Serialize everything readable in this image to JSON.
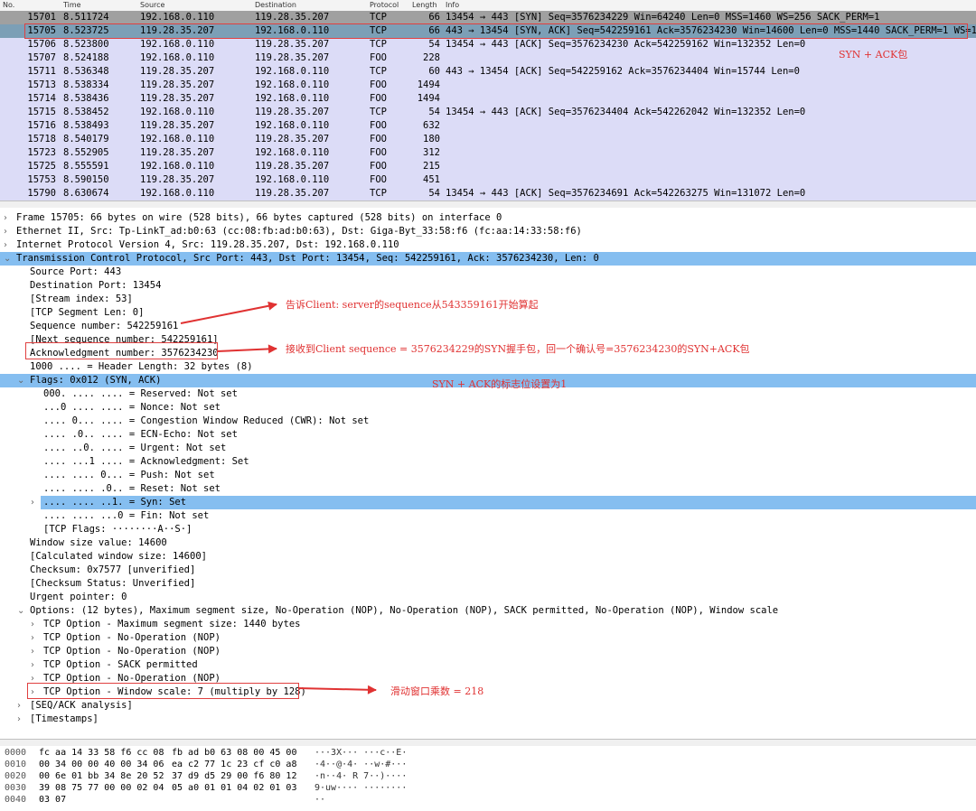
{
  "packet_list": {
    "columns": {
      "no": "No.",
      "time": "Time",
      "source": "Source",
      "destination": "Destination",
      "protocol": "Protocol",
      "length": "Length",
      "info": "Info"
    },
    "rows": [
      {
        "no": "15701",
        "time": "8.511724",
        "src": "192.168.0.110",
        "dst": "119.28.35.207",
        "proto": "TCP",
        "len": "66",
        "info": "13454 → 443 [SYN] Seq=3576234229 Win=64240 Len=0 MSS=1460 WS=256 SACK_PERM=1"
      },
      {
        "no": "15705",
        "time": "8.523725",
        "src": "119.28.35.207",
        "dst": "192.168.0.110",
        "proto": "TCP",
        "len": "66",
        "info": "443 → 13454 [SYN, ACK] Seq=542259161 Ack=3576234230 Win=14600 Len=0 MSS=1440 SACK_PERM=1 WS=128"
      },
      {
        "no": "15706",
        "time": "8.523800",
        "src": "192.168.0.110",
        "dst": "119.28.35.207",
        "proto": "TCP",
        "len": "54",
        "info": "13454 → 443 [ACK] Seq=3576234230 Ack=542259162 Win=132352 Len=0"
      },
      {
        "no": "15707",
        "time": "8.524188",
        "src": "192.168.0.110",
        "dst": "119.28.35.207",
        "proto": "FOO",
        "len": "228",
        "info": ""
      },
      {
        "no": "15711",
        "time": "8.536348",
        "src": "119.28.35.207",
        "dst": "192.168.0.110",
        "proto": "TCP",
        "len": "60",
        "info": "443 → 13454 [ACK] Seq=542259162 Ack=3576234404 Win=15744 Len=0"
      },
      {
        "no": "15713",
        "time": "8.538334",
        "src": "119.28.35.207",
        "dst": "192.168.0.110",
        "proto": "FOO",
        "len": "1494",
        "info": ""
      },
      {
        "no": "15714",
        "time": "8.538436",
        "src": "119.28.35.207",
        "dst": "192.168.0.110",
        "proto": "FOO",
        "len": "1494",
        "info": ""
      },
      {
        "no": "15715",
        "time": "8.538452",
        "src": "192.168.0.110",
        "dst": "119.28.35.207",
        "proto": "TCP",
        "len": "54",
        "info": "13454 → 443 [ACK] Seq=3576234404 Ack=542262042 Win=132352 Len=0"
      },
      {
        "no": "15716",
        "time": "8.538493",
        "src": "119.28.35.207",
        "dst": "192.168.0.110",
        "proto": "FOO",
        "len": "632",
        "info": ""
      },
      {
        "no": "15718",
        "time": "8.540179",
        "src": "192.168.0.110",
        "dst": "119.28.35.207",
        "proto": "FOO",
        "len": "180",
        "info": ""
      },
      {
        "no": "15723",
        "time": "8.552905",
        "src": "119.28.35.207",
        "dst": "192.168.0.110",
        "proto": "FOO",
        "len": "312",
        "info": ""
      },
      {
        "no": "15725",
        "time": "8.555591",
        "src": "192.168.0.110",
        "dst": "119.28.35.207",
        "proto": "FOO",
        "len": "215",
        "info": ""
      },
      {
        "no": "15753",
        "time": "8.590150",
        "src": "119.28.35.207",
        "dst": "192.168.0.110",
        "proto": "FOO",
        "len": "451",
        "info": ""
      },
      {
        "no": "15790",
        "time": "8.630674",
        "src": "192.168.0.110",
        "dst": "119.28.35.207",
        "proto": "TCP",
        "len": "54",
        "info": "13454 → 443 [ACK] Seq=3576234691 Ack=542263275 Win=131072 Len=0"
      }
    ]
  },
  "annotations": {
    "syn_ack_packet": "SYN + ACK包",
    "server_seq": "告诉Client: server的sequence从543359161开始算起",
    "ack_number": "接收到Client sequence = 3576234229的SYN握手包，回一个确认号=3576234230的SYN+ACK包",
    "flags": "SYN + ACK的标志位设置为1",
    "window_scale": "滑动窗口乘数 = 218"
  },
  "details": [
    {
      "text": "Frame 15705: 66 bytes on wire (528 bits), 66 bytes captured (528 bits) on interface 0",
      "arrow": "›"
    },
    {
      "text": "Ethernet II, Src: Tp-LinkT_ad:b0:63 (cc:08:fb:ad:b0:63), Dst: Giga-Byt_33:58:f6 (fc:aa:14:33:58:f6)",
      "arrow": "›"
    },
    {
      "text": "Internet Protocol Version 4, Src: 119.28.35.207, Dst: 192.168.0.110",
      "arrow": "›"
    },
    {
      "text": "Transmission Control Protocol, Src Port: 443, Dst Port: 13454, Seq: 542259161, Ack: 3576234230, Len: 0",
      "arrow": "⌄"
    },
    {
      "text": "Source Port: 443",
      "arrow": ""
    },
    {
      "text": "Destination Port: 13454",
      "arrow": ""
    },
    {
      "text": "[Stream index: 53]",
      "arrow": ""
    },
    {
      "text": "[TCP Segment Len: 0]",
      "arrow": ""
    },
    {
      "text": "Sequence number: 542259161",
      "arrow": ""
    },
    {
      "text": "[Next sequence number: 542259161]",
      "arrow": ""
    },
    {
      "text": "Acknowledgment number: 3576234230",
      "arrow": ""
    },
    {
      "text": "1000 .... = Header Length: 32 bytes (8)",
      "arrow": ""
    },
    {
      "text": "Flags: 0x012 (SYN, ACK)",
      "arrow": "⌄"
    },
    {
      "text": "000. .... .... = Reserved: Not set",
      "arrow": ""
    },
    {
      "text": "...0 .... .... = Nonce: Not set",
      "arrow": ""
    },
    {
      "text": ".... 0... .... = Congestion Window Reduced (CWR): Not set",
      "arrow": ""
    },
    {
      "text": ".... .0.. .... = ECN-Echo: Not set",
      "arrow": ""
    },
    {
      "text": ".... ..0. .... = Urgent: Not set",
      "arrow": ""
    },
    {
      "text": ".... ...1 .... = Acknowledgment: Set",
      "arrow": ""
    },
    {
      "text": ".... .... 0... = Push: Not set",
      "arrow": ""
    },
    {
      "text": ".... .... .0.. = Reset: Not set",
      "arrow": ""
    },
    {
      "text": ".... .... ..1. = Syn: Set",
      "arrow": "›"
    },
    {
      "text": ".... .... ...0 = Fin: Not set",
      "arrow": ""
    },
    {
      "text": "[TCP Flags: ········A··S·]",
      "arrow": ""
    },
    {
      "text": "Window size value: 14600",
      "arrow": ""
    },
    {
      "text": "[Calculated window size: 14600]",
      "arrow": ""
    },
    {
      "text": "Checksum: 0x7577 [unverified]",
      "arrow": ""
    },
    {
      "text": "[Checksum Status: Unverified]",
      "arrow": ""
    },
    {
      "text": "Urgent pointer: 0",
      "arrow": ""
    },
    {
      "text": "Options: (12 bytes), Maximum segment size, No-Operation (NOP), No-Operation (NOP), SACK permitted, No-Operation (NOP), Window scale",
      "arrow": "⌄"
    },
    {
      "text": "TCP Option - Maximum segment size: 1440 bytes",
      "arrow": "›"
    },
    {
      "text": "TCP Option - No-Operation (NOP)",
      "arrow": "›"
    },
    {
      "text": "TCP Option - No-Operation (NOP)",
      "arrow": "›"
    },
    {
      "text": "TCP Option - SACK permitted",
      "arrow": "›"
    },
    {
      "text": "TCP Option - No-Operation (NOP)",
      "arrow": "›"
    },
    {
      "text": "TCP Option - Window scale: 7 (multiply by 128)",
      "arrow": "›"
    },
    {
      "text": "[SEQ/ACK analysis]",
      "arrow": "›"
    },
    {
      "text": "[Timestamps]",
      "arrow": "›"
    }
  ],
  "hex": [
    {
      "offset": "0000",
      "a": "fc aa 14 33 58 f6 cc 08",
      "b": "fb ad b0 63 08 00 45 00",
      "ascii": "···3X··· ···c··E·"
    },
    {
      "offset": "0010",
      "a": "00 34 00 00 40 00 34 06",
      "b": "ea c2 77 1c 23 cf c0 a8",
      "ascii": "·4··@·4· ··w·#···"
    },
    {
      "offset": "0020",
      "a": "00 6e 01 bb 34 8e 20 52",
      "b": "37 d9 d5 29 00 f6 80 12",
      "ascii": "·n··4· R 7··)····"
    },
    {
      "offset": "0030",
      "a": "39 08 75 77 00 00 02 04",
      "b": "05 a0 01 01 04 02 01 03",
      "ascii": "9·uw···· ········"
    },
    {
      "offset": "0040",
      "a": "03 07",
      "b": "",
      "ascii": "··"
    }
  ],
  "colors": {
    "list_bg": "#dcdcf7",
    "selected_row": "#7c9fb6",
    "tree_highlight": "#85bef0",
    "annotation_red": "#e03232"
  }
}
